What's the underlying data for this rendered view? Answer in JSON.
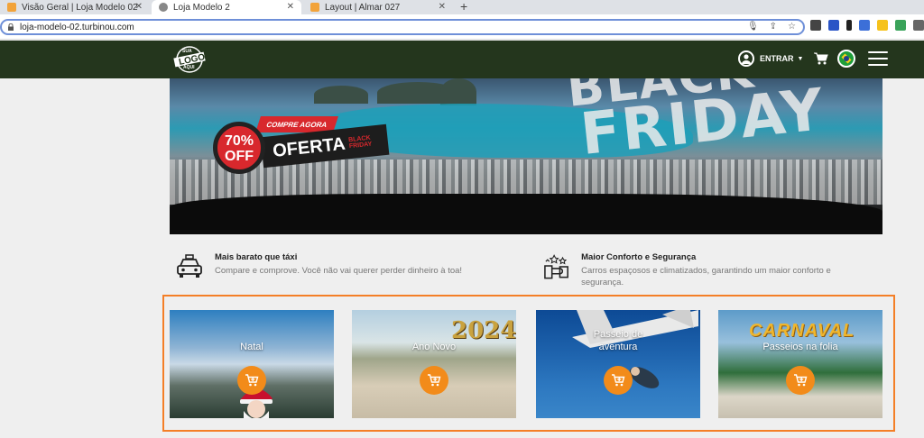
{
  "browser": {
    "tabs": [
      {
        "title": "Visão Geral | Loja Modelo 02",
        "active": false,
        "color": "#f2a33a"
      },
      {
        "title": "Loja Modelo 2",
        "active": true,
        "color": "#888888"
      },
      {
        "title": "Layout | Almar 027",
        "active": false,
        "color": "#f2a33a"
      }
    ],
    "new_tab": "+",
    "url": "loja-modelo-02.turbinou.com"
  },
  "header": {
    "logo_text": "LOGO",
    "logo_top": "SUA",
    "logo_bottom": "AQUI",
    "login_label": "ENTRAR",
    "bg_color": "#24361d"
  },
  "banner": {
    "discount": "70%",
    "off": "OFF",
    "cta": "COMPRE AGORA",
    "offer": "OFERTA",
    "black": "BLACK",
    "friday_small": "FRIDAY",
    "headline_top": "BLACK",
    "headline_bottom": "FRIDAY"
  },
  "features": [
    {
      "title": "Mais barato que táxi",
      "desc": "Compare e comprove. Você não vai querer perder dinheiro à toa!",
      "icon": "taxi-icon"
    },
    {
      "title": "Maior Conforto e Segurança",
      "desc": "Carros espaçosos e climatizados, garantindo um maior conforto e segurança.",
      "icon": "safety-icon"
    }
  ],
  "cards": [
    {
      "title": "Natal"
    },
    {
      "title": "Ano Novo",
      "overlay": "2024"
    },
    {
      "title": "Passeio de aventura"
    },
    {
      "title": "Passeios na folia",
      "overlay": "CARNAVAL"
    }
  ],
  "accent_color": "#f47f27"
}
